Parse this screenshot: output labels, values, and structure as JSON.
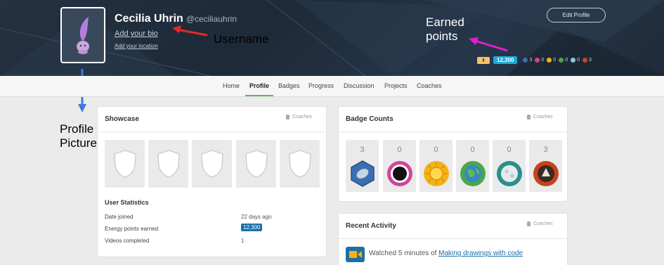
{
  "profile": {
    "name": "Cecilia Uhrin",
    "handle": "@ceciliauhrin",
    "bio_link": "Add your bio",
    "location_link": "Add your location",
    "edit_button": "Edit Profile",
    "points": "12,300",
    "mini_badges": [
      "3",
      "0",
      "0",
      "0",
      "0",
      "3"
    ]
  },
  "annotations": {
    "username": "Username",
    "earned_points": [
      "Earned",
      "points"
    ],
    "profile_picture": [
      "Profile",
      "Picture"
    ]
  },
  "nav": {
    "tabs": [
      "Home",
      "Profile",
      "Badges",
      "Progress",
      "Discussion",
      "Projects",
      "Coaches"
    ],
    "active": "Profile"
  },
  "showcase": {
    "title": "Showcase",
    "coaches": "Coaches",
    "stats_title": "User Statistics",
    "stats": [
      {
        "label": "Date joined",
        "value": "22 days ago"
      },
      {
        "label": "Energy points earned",
        "value": "12,300"
      },
      {
        "label": "Videos completed",
        "value": "1"
      }
    ]
  },
  "badge_counts": {
    "title": "Badge Counts",
    "coaches": "Coaches",
    "counts": [
      "3",
      "0",
      "0",
      "0",
      "0",
      "3"
    ],
    "colors": [
      "#3c6fb0",
      "#d2449a",
      "#f2b316",
      "#49a84c",
      "#2a8f8c",
      "#c9421f"
    ]
  },
  "recent_activity": {
    "title": "Recent Activity",
    "coaches": "Coaches",
    "prefix": "Watched 5 minutes of",
    "link": "Making drawings with code"
  }
}
